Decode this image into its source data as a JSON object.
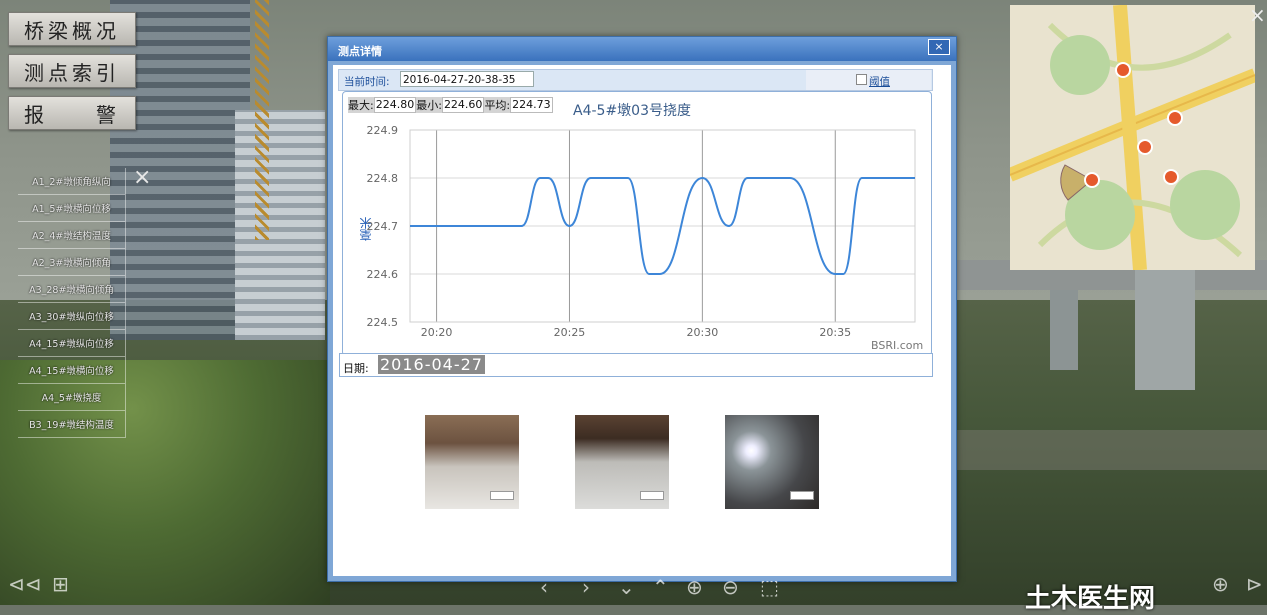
{
  "left_menu": {
    "buttons": [
      "桥梁概况",
      "测点索引",
      "报　　警"
    ]
  },
  "point_list": {
    "items": [
      "A1_2#墩倾角纵向",
      "A1_5#墩横向位移",
      "A2_4#墩结构温度",
      "A2_3#墩横向倾角",
      "A3_28#墩横向倾角",
      "A3_30#墩纵向位移",
      "A4_15#墩纵向位移",
      "A4_15#墩横向位移",
      "A4_5#墩挠度",
      "B3_19#墩结构温度"
    ],
    "close_icon": "×"
  },
  "dialog": {
    "title": "测点详情",
    "close_label": "×",
    "current_time_label": "当前时间:",
    "current_time_value": "2016-04-27-20-38-35",
    "threshold_label": "阈值",
    "stats": {
      "max_label": "最大:",
      "max_value": "224.80",
      "min_label": "最小:",
      "min_value": "224.60",
      "avg_label": "平均:",
      "avg_value": "224.73"
    },
    "credit": "BSRI.com",
    "date_label": "日期:",
    "date_value": "2016-04-27"
  },
  "chart_data": {
    "type": "line",
    "title": "A4-5#墩03号挠度",
    "ylabel": "毫米",
    "xlabel": "",
    "ylim": [
      224.5,
      224.9
    ],
    "yticks": [
      "224.9",
      "224.8",
      "224.7",
      "224.6",
      "224.5"
    ],
    "xticks": [
      "20:20",
      "20:25",
      "20:30",
      "20:35"
    ],
    "x_range_minutes": [
      19.0,
      38.0
    ],
    "series": [
      {
        "color": "#3d86d8",
        "points": [
          [
            19.0,
            224.7
          ],
          [
            23.2,
            224.7
          ],
          [
            23.9,
            224.8
          ],
          [
            24.2,
            224.8
          ],
          [
            25.0,
            224.7
          ],
          [
            25.8,
            224.8
          ],
          [
            27.2,
            224.8
          ],
          [
            28.0,
            224.6
          ],
          [
            28.4,
            224.6
          ],
          [
            30.0,
            224.8
          ],
          [
            31.0,
            224.7
          ],
          [
            31.7,
            224.8
          ],
          [
            33.3,
            224.8
          ],
          [
            35.0,
            224.6
          ],
          [
            35.3,
            224.6
          ],
          [
            36.0,
            224.8
          ],
          [
            38.0,
            224.8
          ]
        ]
      }
    ]
  },
  "bottom_bar": {
    "icons": [
      "⊲⊲",
      "⊞",
      "‹",
      "›",
      "⌄",
      "⌃",
      "⊕",
      "⊖",
      "⬚",
      "⊕",
      "⊳"
    ]
  },
  "watermark": "土木医生网",
  "close_top_right": "×"
}
